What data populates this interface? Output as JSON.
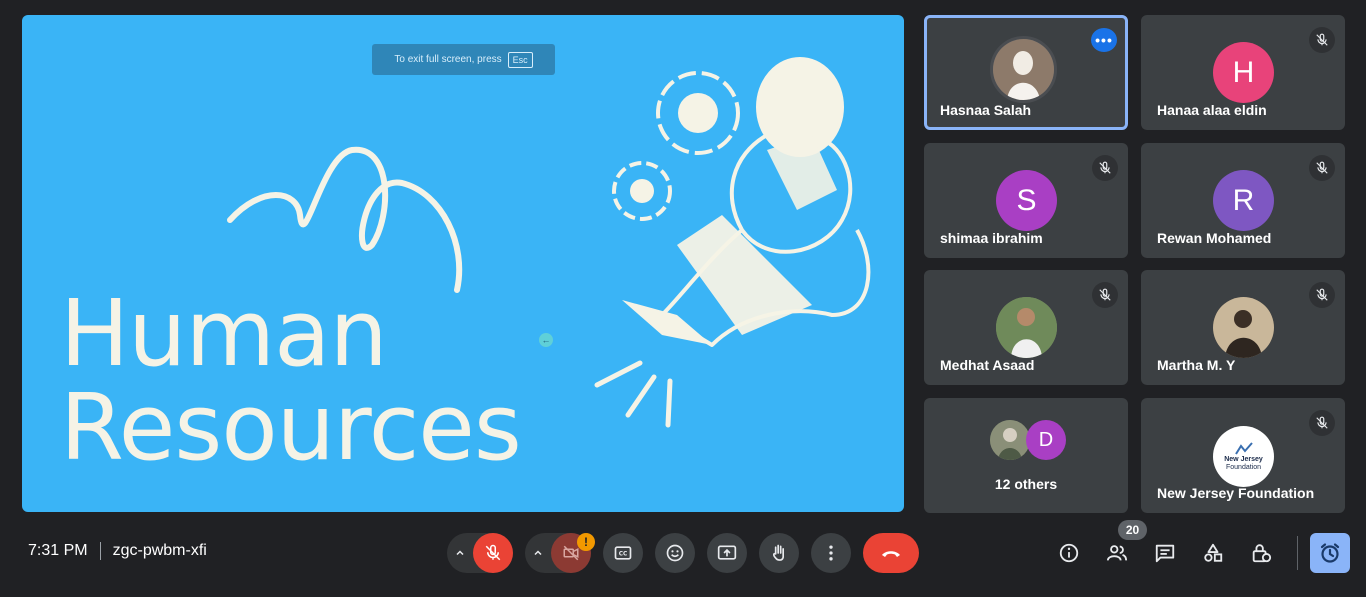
{
  "presentation": {
    "exit_hint": "To exit full screen, press",
    "exit_key": "Esc",
    "title_line1": "Human",
    "title_line2": "Resources"
  },
  "participants": [
    {
      "name": "Hasnaa Salah",
      "active": true,
      "avatar": "photo"
    },
    {
      "name": "Hanaa alaa eldin",
      "initial": "H",
      "color": "#e8437a"
    },
    {
      "name": "shimaa ibrahim",
      "initial": "S",
      "color": "#a93fc4"
    },
    {
      "name": "Rewan Mohamed",
      "initial": "R",
      "color": "#7e57c2"
    },
    {
      "name": "Medhat Asaad",
      "avatar": "photo"
    },
    {
      "name": "Martha M. Y",
      "avatar": "photo"
    },
    {
      "others_label": "12 others",
      "initial": "D",
      "color": "#a93fc4"
    },
    {
      "name": "New Jersey Foundation",
      "logo_text": "New Jersey",
      "logo_sub": "Foundation"
    }
  ],
  "meeting": {
    "time": "7:31 PM",
    "code": "zgc-pwbm-xfi",
    "people_count": "20",
    "camera_warning": "!"
  },
  "icons": {
    "mic": "mic-off-icon",
    "camera": "videocam-off-icon",
    "captions": "closed-caption-icon",
    "emoji": "emoji-icon",
    "present": "present-screen-icon",
    "hand": "raise-hand-icon",
    "more": "more-vert-icon",
    "hangup": "call-end-icon",
    "info": "info-icon",
    "people": "people-icon",
    "chat": "chat-icon",
    "activities": "activities-icon",
    "host_controls": "lock-person-icon",
    "timer": "alarm-icon"
  },
  "colors": {
    "slide_bg": "#3ab4f6",
    "danger": "#ea4335",
    "accent": "#8ab4f8"
  }
}
